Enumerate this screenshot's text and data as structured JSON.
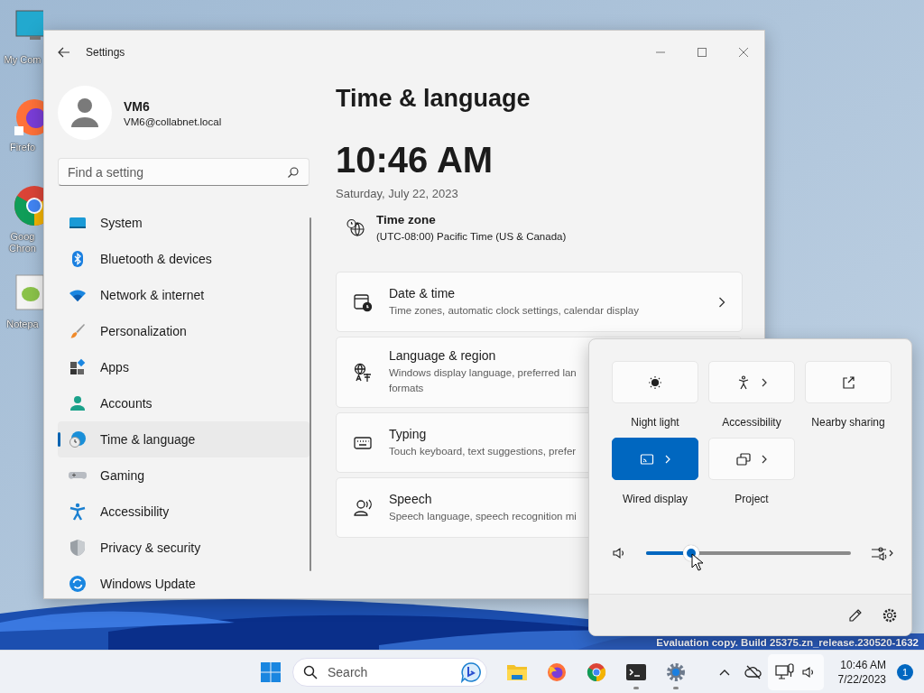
{
  "desktop": {
    "icons": [
      {
        "label": "My Com"
      },
      {
        "label": "Firefo"
      },
      {
        "label": "Goog Chron"
      },
      {
        "label": "Notepa"
      }
    ],
    "watermark": "Evaluation copy. Build 25375.zn_release.230520-1632"
  },
  "settings_window": {
    "title": "Settings",
    "user": {
      "name": "VM6",
      "email": "VM6@collabnet.local"
    },
    "search": {
      "placeholder": "Find a setting"
    },
    "nav": [
      {
        "label": "System",
        "selected": false
      },
      {
        "label": "Bluetooth & devices",
        "selected": false
      },
      {
        "label": "Network & internet",
        "selected": false
      },
      {
        "label": "Personalization",
        "selected": false
      },
      {
        "label": "Apps",
        "selected": false
      },
      {
        "label": "Accounts",
        "selected": false
      },
      {
        "label": "Time & language",
        "selected": true
      },
      {
        "label": "Gaming",
        "selected": false
      },
      {
        "label": "Accessibility",
        "selected": false
      },
      {
        "label": "Privacy & security",
        "selected": false
      },
      {
        "label": "Windows Update",
        "selected": false
      }
    ],
    "page": {
      "heading": "Time & language",
      "clock": "10:46 AM",
      "date": "Saturday, July 22, 2023",
      "time_zone": {
        "label": "Time zone",
        "value": "(UTC-08:00) Pacific Time (US & Canada)"
      },
      "cards": [
        {
          "title": "Date & time",
          "subtitle": "Time zones, automatic clock settings, calendar display",
          "chevron": true
        },
        {
          "title": "Language & region",
          "subtitle": "Windows display language, preferred lan\nformats",
          "chevron": false
        },
        {
          "title": "Typing",
          "subtitle": "Touch keyboard, text suggestions, prefer",
          "chevron": false
        },
        {
          "title": "Speech",
          "subtitle": "Speech language, speech recognition mi",
          "chevron": false
        }
      ]
    }
  },
  "quick_settings": {
    "tiles": [
      {
        "label": "Night light",
        "on": false,
        "chevron": false
      },
      {
        "label": "Accessibility",
        "on": false,
        "chevron": true
      },
      {
        "label": "Nearby sharing",
        "on": false,
        "chevron": false
      },
      {
        "label": "Wired display",
        "on": true,
        "chevron": true
      },
      {
        "label": "Project",
        "on": false,
        "chevron": true
      }
    ],
    "volume": {
      "level": 0.22
    }
  },
  "taskbar": {
    "search": {
      "placeholder": "Search"
    },
    "apps": [
      {
        "kind": "explorer",
        "running": false
      },
      {
        "kind": "firefox",
        "running": false
      },
      {
        "kind": "chrome",
        "running": false
      },
      {
        "kind": "terminal",
        "running": true
      },
      {
        "kind": "settings",
        "running": true
      }
    ],
    "clock": {
      "time": "10:46 AM",
      "date": "7/22/2023"
    },
    "notifications": "1"
  }
}
